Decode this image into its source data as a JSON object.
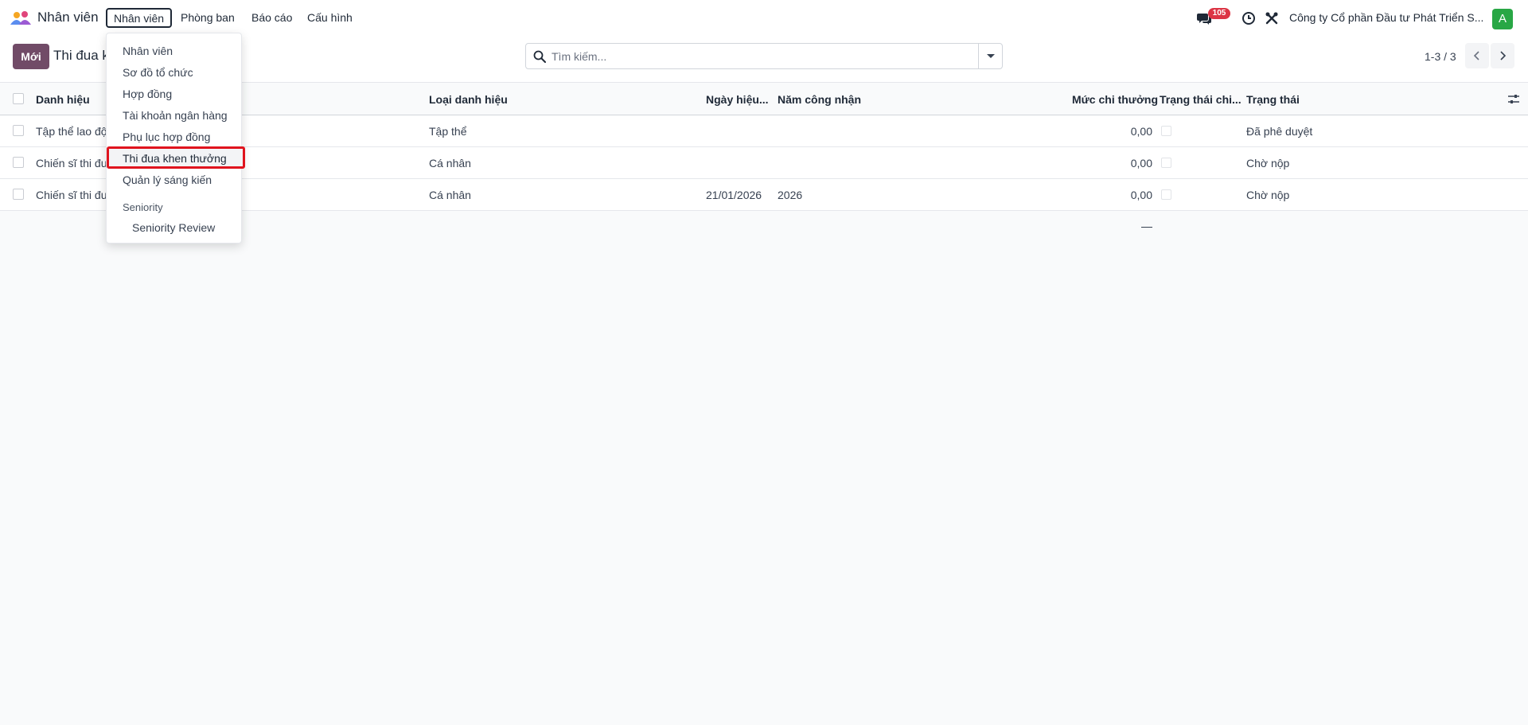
{
  "navbar": {
    "app_name": "Nhân viên",
    "menu": [
      "Nhân viên",
      "Phòng ban",
      "Báo cáo",
      "Cấu hình"
    ],
    "messages_badge": "105",
    "company": "Công ty Cổ phần Đầu tư Phát Triển S...",
    "avatar_letter": "A"
  },
  "control": {
    "new_button": "Mới",
    "breadcrumb": "Thi đua k",
    "search_placeholder": "Tìm kiếm...",
    "pager": "1-3 / 3"
  },
  "table": {
    "columns": [
      "Danh hiệu",
      "Loại danh hiệu",
      "Ngày hiệu...",
      "Năm công nhận",
      "Mức chi thưởng",
      "Trạng thái chi...",
      "Trạng thái"
    ],
    "rows": [
      {
        "danh_hieu": "Tập thể lao độ",
        "loai": "Tập thể",
        "ngay": "",
        "nam": "",
        "muc": "0,00",
        "trang_thai": "Đã phê duyệt"
      },
      {
        "danh_hieu": "Chiến sĩ thi đu",
        "loai": "Cá nhân",
        "ngay": "",
        "nam": "",
        "muc": "0,00",
        "trang_thai": "Chờ nộp"
      },
      {
        "danh_hieu": "Chiến sĩ thi đu",
        "loai": "Cá nhân",
        "ngay": "21/01/2026",
        "nam": "2026",
        "muc": "0,00",
        "trang_thai": "Chờ nộp"
      }
    ]
  },
  "dropdown": {
    "items": [
      "Nhân viên",
      "Sơ đồ tổ chức",
      "Hợp đồng",
      "Tài khoản ngân hàng",
      "Phụ lục hợp đồng",
      "Thi đua khen thưởng",
      "Quản lý sáng kiến"
    ],
    "section": "Seniority",
    "sub_item": "Seniority Review"
  },
  "colors": {
    "brand": "#714b67",
    "highlight_border": "#e0141e",
    "badge": "#dc3545",
    "avatar": "#28a745"
  }
}
